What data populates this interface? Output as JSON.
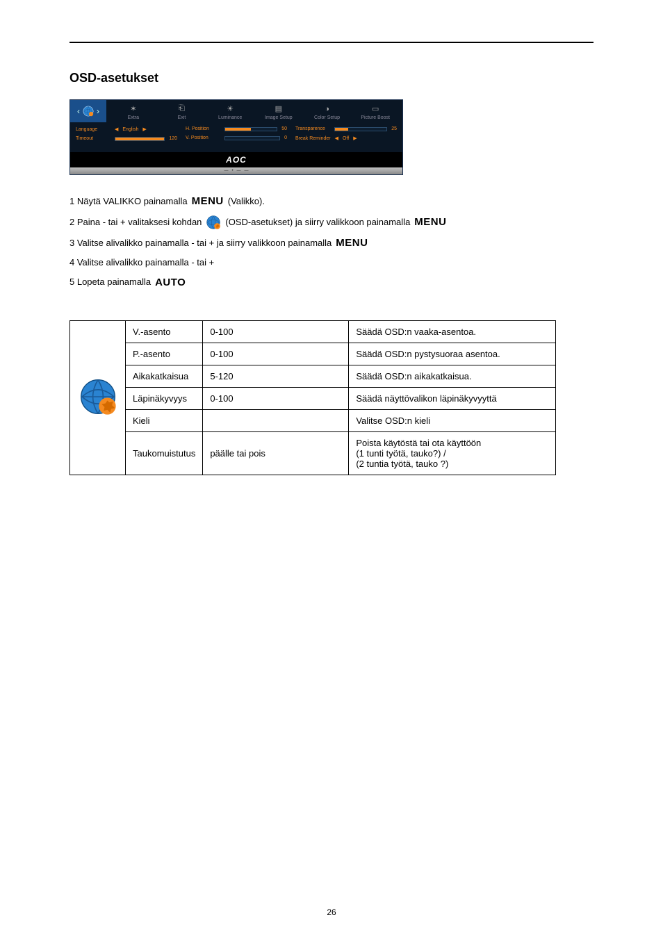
{
  "heading": "OSD-asetukset",
  "osd": {
    "tabs": [
      "Extra",
      "Exit",
      "Luminance",
      "Image Setup",
      "Color Setup",
      "Picture Boost"
    ],
    "rows": {
      "language_label": "Language",
      "language_value": "English",
      "timeout_label": "Timeout",
      "timeout_value": "120",
      "hpos_label": "H. Position",
      "hpos_value": "50",
      "vpos_label": "V. Position",
      "vpos_value": "0",
      "trans_label": "Transparence",
      "trans_value": "25",
      "break_label": "Break Reminder",
      "break_value": "Off"
    },
    "brand": "AOC"
  },
  "instr": {
    "l1a": "1 Näytä VALIKKO painamalla",
    "l1b": "(Valikko).",
    "l2a": "2 Paina - tai + valitaksesi kohdan",
    "l2b": "(OSD-asetukset) ja siirry valikkoon painamalla",
    "l3a": "3 Valitse alivalikko painamalla - tai + ja siirry valikkoon painamalla",
    "l4": "4 Valitse alivalikko painamalla - tai +",
    "l5": "5 Lopeta painamalla",
    "menu": "MENU",
    "auto": "AUTO"
  },
  "table": {
    "rows": [
      {
        "name": "V.-asento",
        "range": "0-100",
        "desc": "Säädä OSD:n vaaka-asentoa."
      },
      {
        "name": "P.-asento",
        "range": "0-100",
        "desc": "Säädä OSD:n pystysuoraa asentoa."
      },
      {
        "name": "Aikakatkaisua",
        "range": "5-120",
        "desc": "Säädä OSD:n aikakatkaisua."
      },
      {
        "name": "Läpinäkyvyys",
        "range": "0-100",
        "desc": "Säädä näyttövalikon läpinäkyvyyttä"
      },
      {
        "name": "Kieli",
        "range": "",
        "desc": "Valitse OSD:n kieli"
      },
      {
        "name": "Taukomuistutus",
        "range": "päälle tai pois",
        "desc": "Poista käytöstä tai ota käyttöön\n(1 tunti työtä, tauko?) /\n(2 tuntia työtä, tauko ?)"
      }
    ]
  },
  "pageNumber": "26"
}
